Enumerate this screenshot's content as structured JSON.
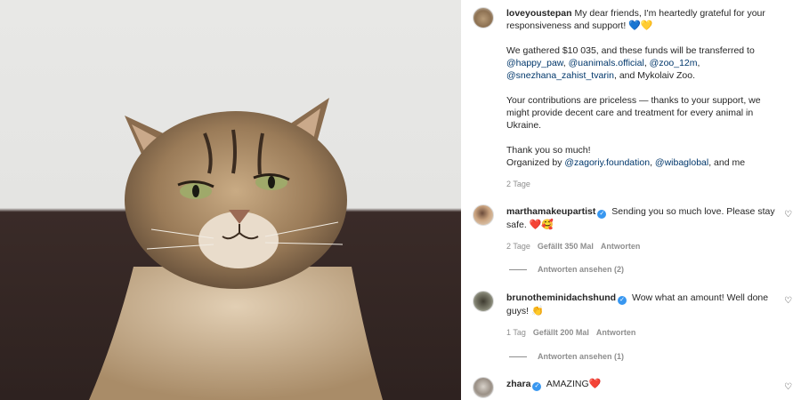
{
  "post": {
    "username": "loveyoustepan",
    "caption_line1": "My dear friends, I'm heartedly grateful for your responsiveness and support!",
    "caption_emoji": "💙💛",
    "p2_text": "We gathered $10 035, and these funds will be transferred to",
    "mentions_1": [
      "@happy_paw",
      "@uanimals.official",
      "@zoo_12m",
      "@snezhana_zahist_tvarin"
    ],
    "p2_tail": ", and Mykolaiv Zoo.",
    "p3": "Your contributions are priceless — thanks to your support, we might provide decent care and treatment for every animal in Ukraine.",
    "p4_line1": "Thank you so much!",
    "organized_prefix": "Organized by",
    "organized_link1": "@zagoriy.foundation",
    "organized_link2": "@wibaglobal",
    "organized_tail": ", and me",
    "timestamp": "2 Tage"
  },
  "comments": [
    {
      "username": "marthamakeupartist",
      "verified": true,
      "text": "Sending you so much love. Please stay safe.",
      "emoji": "❤️🥰",
      "time": "2 Tage",
      "likes": "Gefällt 350 Mal",
      "reply": "Antworten",
      "view_replies": "Antworten ansehen (2)"
    },
    {
      "username": "brunotheminidachshund",
      "verified": true,
      "text": "Wow what an amount! Well done guys!",
      "emoji": "👏",
      "time": "1 Tag",
      "likes": "Gefällt 200 Mal",
      "reply": "Antworten",
      "view_replies": "Antworten ansehen (1)"
    },
    {
      "username": "zhara",
      "verified": true,
      "text": "AMAZING",
      "emoji": "❤️"
    }
  ],
  "icons": {
    "heart": "heart-outline-icon",
    "verified": "verified-badge-icon"
  },
  "colors": {
    "link": "#00376b",
    "verified": "#3897f0",
    "meta": "#8e8e8e"
  }
}
